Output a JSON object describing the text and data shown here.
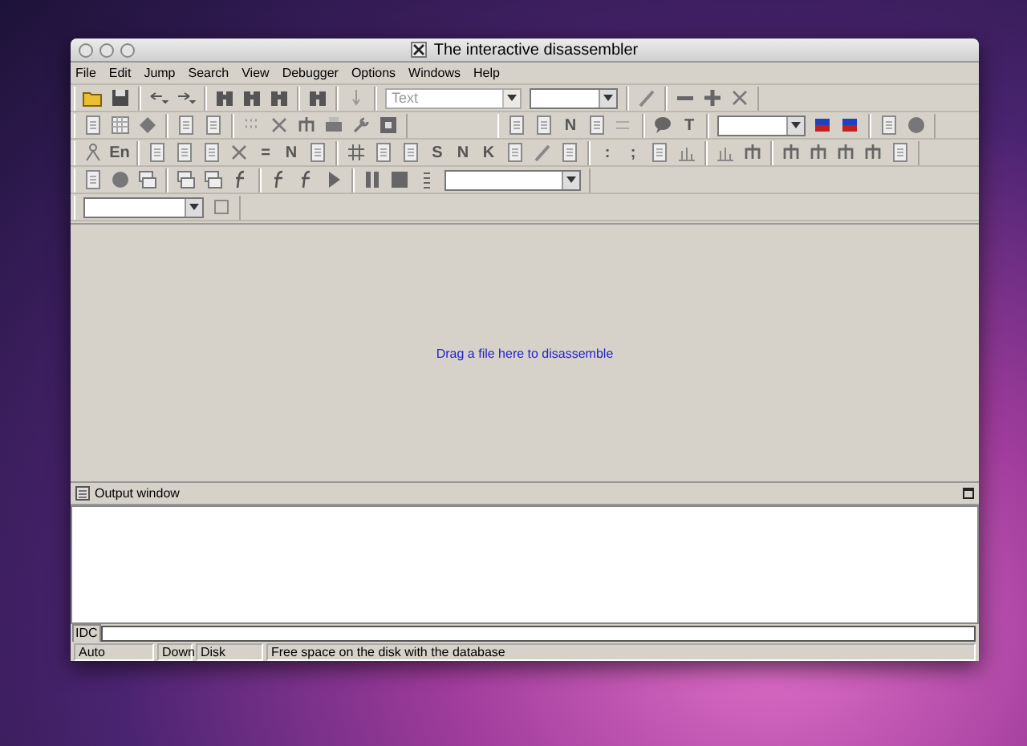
{
  "window": {
    "title": "The interactive disassembler"
  },
  "menu": [
    {
      "label": "File"
    },
    {
      "label": "Edit"
    },
    {
      "label": "Jump"
    },
    {
      "label": "Search"
    },
    {
      "label": "View"
    },
    {
      "label": "Debugger"
    },
    {
      "label": "Options"
    },
    {
      "label": "Windows"
    },
    {
      "label": "Help"
    }
  ],
  "toolbars": [
    [
      [
        {
          "kind": "icon"
        },
        {
          "kind": "icon"
        }
      ],
      [
        {
          "kind": "icon"
        },
        {
          "kind": "icon"
        }
      ],
      [
        {
          "kind": "icon"
        },
        {
          "kind": "icon"
        },
        {
          "kind": "icon"
        }
      ],
      [
        {
          "kind": "icon"
        }
      ],
      [
        {
          "kind": "icon"
        }
      ],
      [
        {
          "kind": "combo",
          "value": "Text",
          "disabled": true
        },
        {
          "kind": "combo",
          "disabled": false
        }
      ],
      [
        {
          "kind": "icon"
        }
      ],
      [
        {
          "kind": "icon"
        },
        {
          "kind": "icon"
        },
        {
          "kind": "icon"
        }
      ]
    ],
    [
      [
        {
          "kind": "icon"
        },
        {
          "kind": "icon"
        },
        {
          "kind": "icon"
        }
      ],
      [
        {
          "kind": "icon"
        },
        {
          "kind": "icon"
        }
      ],
      [
        {
          "kind": "icon"
        },
        {
          "kind": "icon"
        },
        {
          "kind": "icon"
        },
        {
          "kind": "icon"
        },
        {
          "kind": "icon"
        },
        {
          "kind": "icon"
        }
      ],
      [
        {
          "kind": "spacer"
        }
      ],
      [
        {
          "kind": "icon"
        },
        {
          "kind": "icon"
        },
        {
          "kind": "glyph",
          "text": "N"
        },
        {
          "kind": "icon"
        },
        {
          "kind": "icon"
        }
      ],
      [
        {
          "kind": "icon"
        },
        {
          "kind": "glyph",
          "text": "T"
        }
      ],
      [
        {
          "kind": "combo",
          "disabled": false
        },
        {
          "kind": "icon"
        },
        {
          "kind": "icon"
        }
      ],
      [
        {
          "kind": "icon"
        },
        {
          "kind": "icon"
        }
      ]
    ],
    [
      [
        {
          "kind": "icon"
        },
        {
          "kind": "glyph",
          "text": "En"
        }
      ],
      [
        {
          "kind": "icon"
        },
        {
          "kind": "icon"
        },
        {
          "kind": "icon"
        },
        {
          "kind": "icon"
        },
        {
          "kind": "glyph",
          "text": "="
        },
        {
          "kind": "glyph",
          "text": "N"
        },
        {
          "kind": "icon"
        }
      ],
      [
        {
          "kind": "icon"
        },
        {
          "kind": "icon"
        },
        {
          "kind": "icon"
        },
        {
          "kind": "glyph",
          "text": "S"
        },
        {
          "kind": "glyph",
          "text": "N"
        },
        {
          "kind": "glyph",
          "text": "K"
        },
        {
          "kind": "icon"
        },
        {
          "kind": "icon"
        },
        {
          "kind": "icon"
        }
      ],
      [
        {
          "kind": "glyph",
          "text": ":"
        },
        {
          "kind": "glyph",
          "text": ";"
        },
        {
          "kind": "icon"
        },
        {
          "kind": "icon"
        }
      ],
      [
        {
          "kind": "icon"
        },
        {
          "kind": "icon"
        }
      ],
      [
        {
          "kind": "icon"
        },
        {
          "kind": "icon"
        },
        {
          "kind": "icon"
        },
        {
          "kind": "icon"
        },
        {
          "kind": "icon"
        }
      ]
    ],
    [
      [
        {
          "kind": "icon"
        },
        {
          "kind": "icon"
        },
        {
          "kind": "icon"
        }
      ],
      [
        {
          "kind": "icon"
        },
        {
          "kind": "icon"
        },
        {
          "kind": "icon"
        }
      ],
      [
        {
          "kind": "icon"
        },
        {
          "kind": "icon"
        },
        {
          "kind": "icon"
        }
      ],
      [
        {
          "kind": "icon"
        },
        {
          "kind": "icon"
        },
        {
          "kind": "icon"
        },
        {
          "kind": "combo",
          "disabled": false
        }
      ]
    ],
    [
      [
        {
          "kind": "combo",
          "disabled": false
        },
        {
          "kind": "icon"
        }
      ]
    ]
  ],
  "workspace": {
    "hint": "Drag a file here to disassemble"
  },
  "output_window": {
    "title": "Output window",
    "command_label": "IDC"
  },
  "status_bar": [
    "Auto",
    "Down",
    "Disk",
    "Free space on the disk with the database"
  ]
}
